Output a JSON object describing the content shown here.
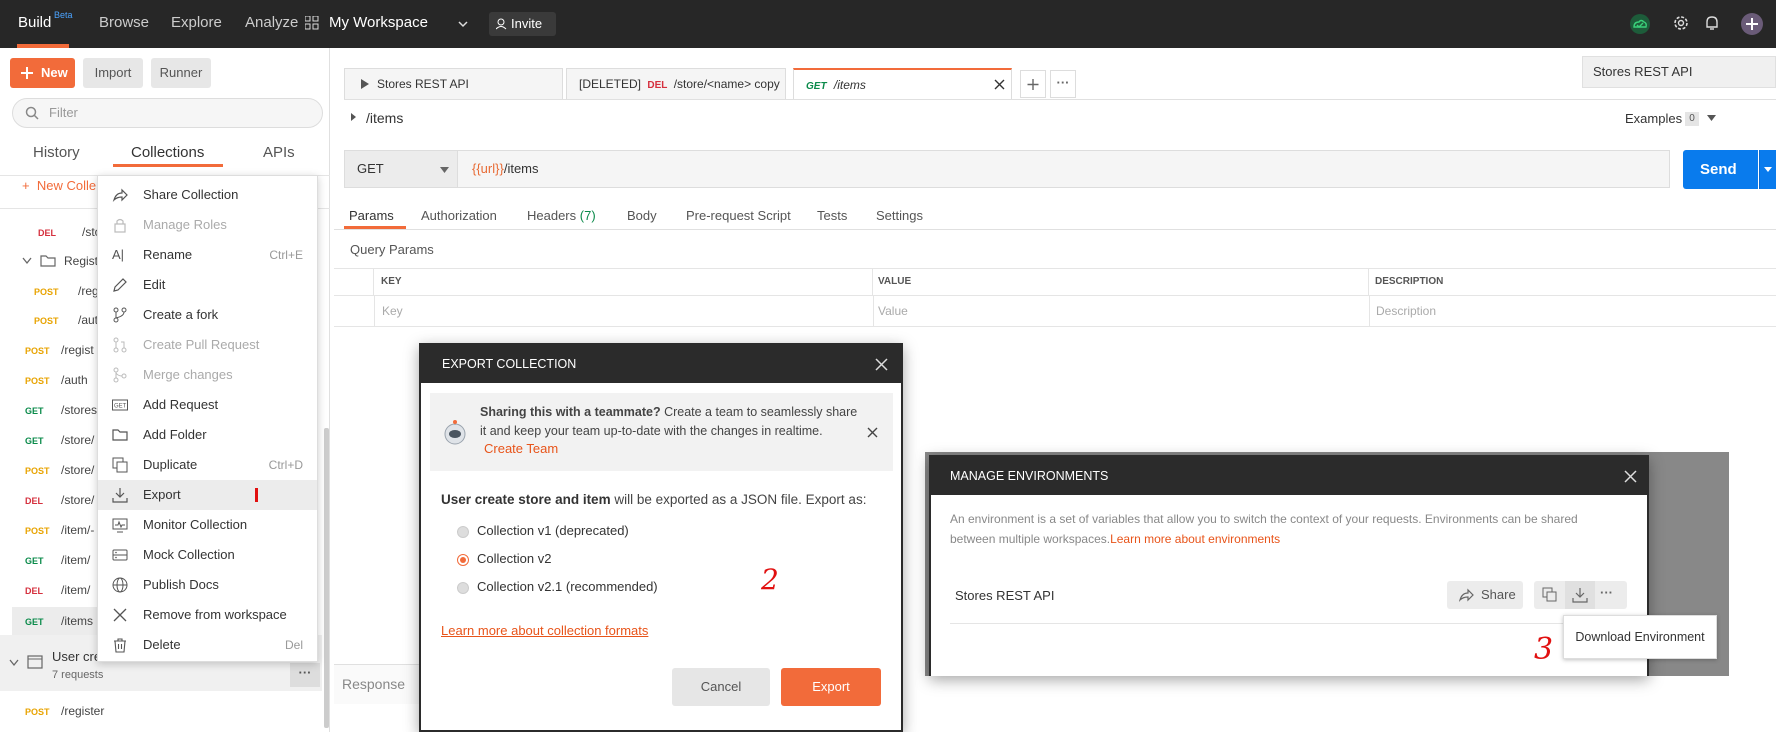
{
  "topbar": {
    "brand": "Build",
    "brand_badge": "Beta",
    "nav": [
      "Browse",
      "Explore",
      "Analyze"
    ],
    "workspace": "My Workspace",
    "invite": "Invite"
  },
  "sidebar": {
    "new_button": "New",
    "import_button": "Import",
    "runner_button": "Runner",
    "filter_placeholder": "Filter",
    "tabs": [
      "History",
      "Collections",
      "APIs"
    ],
    "new_collection": "New Colle",
    "rows": [
      {
        "method": "DEL",
        "path": "/stor"
      },
      {
        "method": "",
        "path": "Regist"
      },
      {
        "method": "POST",
        "path": "/regis"
      },
      {
        "method": "POST",
        "path": "/auth"
      },
      {
        "method": "POST",
        "path": "/regist"
      },
      {
        "method": "POST",
        "path": "/auth"
      },
      {
        "method": "GET",
        "path": "/stores"
      },
      {
        "method": "GET",
        "path": "/store/"
      },
      {
        "method": "POST",
        "path": "/store/"
      },
      {
        "method": "DEL",
        "path": "/store/"
      },
      {
        "method": "POST",
        "path": "/item/-"
      },
      {
        "method": "GET",
        "path": "/item/"
      },
      {
        "method": "DEL",
        "path": "/item/"
      },
      {
        "method": "GET",
        "path": "/items"
      }
    ],
    "collection": {
      "name": "User cre",
      "count": "7 requests"
    },
    "last_row": {
      "method": "POST",
      "path": "/register"
    }
  },
  "context_menu": {
    "items": [
      {
        "label": "Share Collection",
        "icon": "share-icon",
        "shortcut": "",
        "disabled": false
      },
      {
        "label": "Manage Roles",
        "icon": "lock-icon",
        "shortcut": "",
        "disabled": true
      },
      {
        "label": "Rename",
        "icon": "rename-icon",
        "shortcut": "Ctrl+E",
        "disabled": false
      },
      {
        "label": "Edit",
        "icon": "pencil-icon",
        "shortcut": "",
        "disabled": false
      },
      {
        "label": "Create a fork",
        "icon": "fork-icon",
        "shortcut": "",
        "disabled": false
      },
      {
        "label": "Create Pull Request",
        "icon": "pull-request-icon",
        "shortcut": "",
        "disabled": true
      },
      {
        "label": "Merge changes",
        "icon": "merge-icon",
        "shortcut": "",
        "disabled": true
      },
      {
        "label": "Add Request",
        "icon": "get-request-icon",
        "shortcut": "",
        "disabled": false
      },
      {
        "label": "Add Folder",
        "icon": "folder-icon",
        "shortcut": "",
        "disabled": false
      },
      {
        "label": "Duplicate",
        "icon": "duplicate-icon",
        "shortcut": "Ctrl+D",
        "disabled": false
      },
      {
        "label": "Export",
        "icon": "download-icon",
        "shortcut": "",
        "disabled": false
      },
      {
        "label": "Monitor Collection",
        "icon": "monitor-icon",
        "shortcut": "",
        "disabled": false
      },
      {
        "label": "Mock Collection",
        "icon": "mock-server-icon",
        "shortcut": "",
        "disabled": false
      },
      {
        "label": "Publish Docs",
        "icon": "globe-icon",
        "shortcut": "",
        "disabled": false
      },
      {
        "label": "Remove from workspace",
        "icon": "close-icon",
        "shortcut": "",
        "disabled": false
      },
      {
        "label": "Delete",
        "icon": "trash-icon",
        "shortcut": "Del",
        "disabled": false
      }
    ]
  },
  "tabs": [
    {
      "label": "Stores REST API"
    },
    {
      "prefix": "[DELETED]",
      "method": "DEL",
      "label": "/store/<name> copy"
    },
    {
      "method": "GET",
      "label": "/items"
    }
  ],
  "env_selector": "Stores REST API",
  "request": {
    "breadcrumb": "/items",
    "examples_label": "Examples",
    "examples_count": "0",
    "method": "GET",
    "url_var": "{{url}}",
    "url_path": "/items",
    "send": "Send",
    "subtabs": [
      "Params",
      "Authorization",
      "Headers",
      "Body",
      "Pre-request Script",
      "Tests",
      "Settings"
    ],
    "headers_count": "(7)",
    "query_params_title": "Query Params",
    "columns": [
      "KEY",
      "VALUE",
      "DESCRIPTION"
    ],
    "placeholders": [
      "Key",
      "Value",
      "Description"
    ],
    "response_label": "Response"
  },
  "export_dialog": {
    "title": "EXPORT COLLECTION",
    "banner_bold": "Sharing this with a teammate?",
    "banner_text_1": " Create a team to seamlessly share",
    "banner_text_2": "it and keep your team up-to-date with the changes in realtime.",
    "create_team": "Create Team",
    "collection_name": "User create store and item",
    "intro_text": " will be exported as a JSON file. Export as:",
    "options": [
      "Collection v1 (deprecated)",
      "Collection v2",
      "Collection v2.1 (recommended)"
    ],
    "selected_index": 1,
    "learn_more": "Learn more about collection formats",
    "cancel": "Cancel",
    "export": "Export",
    "annotation": "2"
  },
  "env_dialog": {
    "title": "MANAGE ENVIRONMENTS",
    "description_1": "An environment is a set of variables that allow you to switch the context of your requests. Environments can be shared",
    "description_2": "between multiple workspaces.",
    "learn_more": "Learn more about environments",
    "environment_name": "Stores REST API",
    "share": "Share",
    "tooltip": "Download Environment",
    "annotation": "3"
  },
  "colors": {
    "accent": "#f26b3a",
    "send_blue": "#097bed",
    "get": "#0a8a4a",
    "post": "#e8a300",
    "del": "#d5303e",
    "annotation_red": "#e11010"
  }
}
